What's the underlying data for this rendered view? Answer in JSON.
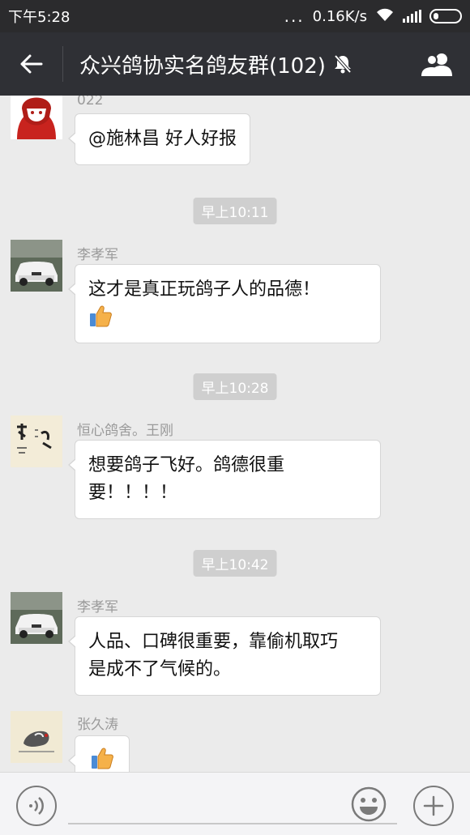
{
  "status_bar": {
    "time": "下午5:28",
    "dots": "...",
    "speed": "0.16K/s"
  },
  "header": {
    "title": "众兴鸽协实名鸽友群(102)"
  },
  "messages": [
    {
      "sender": "022",
      "text_lines": [
        "@施林昌 好人好报"
      ]
    },
    {
      "timestamp": "早上10:11"
    },
    {
      "sender": "李孝军",
      "text_lines": [
        "这才是真正玩鸽子人的品德！"
      ],
      "has_thumb": true
    },
    {
      "timestamp": "早上10:28"
    },
    {
      "sender": "恒心鸽舍。王刚",
      "text_lines": [
        "想要鸽子飞好。鸽德很重",
        "要！！！！"
      ]
    },
    {
      "timestamp": "早上10:42"
    },
    {
      "sender": "李孝军",
      "text_lines": [
        "人品、口碑很重要，靠偷机取巧",
        "是成不了气候的。"
      ]
    },
    {
      "sender": "张久涛",
      "has_thumb": true
    }
  ],
  "colors": {
    "status_bg": "#2b2b2d",
    "title_bg": "#2f3035",
    "chat_bg": "#ebebeb",
    "timestamp_bg": "#cfcfcf"
  },
  "icons": [
    "back-arrow-icon",
    "mute-bell-icon",
    "members-icon",
    "thumbs-up-icon",
    "voice-icon",
    "emoji-icon",
    "plus-icon",
    "wifi-icon",
    "signal-icon",
    "battery-icon"
  ]
}
